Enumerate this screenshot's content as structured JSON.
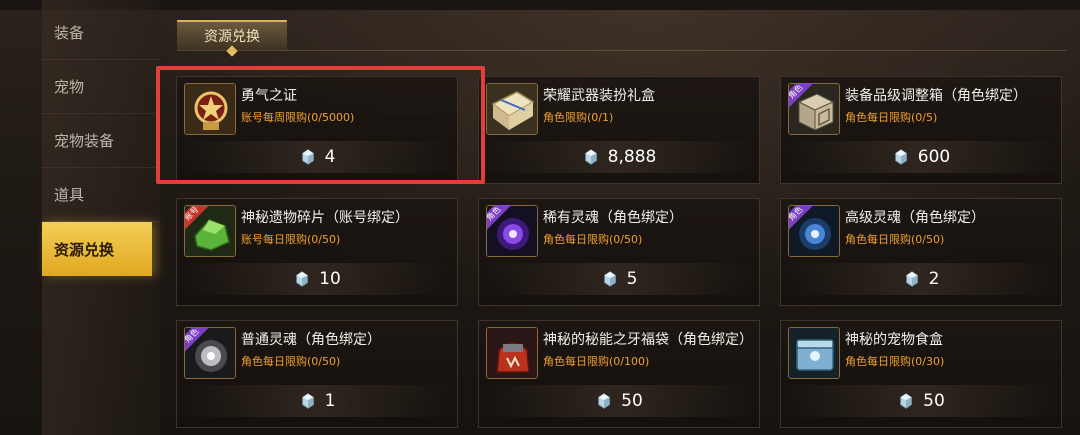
{
  "sidebar": {
    "items": [
      {
        "label": "装备"
      },
      {
        "label": "宠物"
      },
      {
        "label": "宠物装备"
      },
      {
        "label": "道具"
      },
      {
        "label": "资源兑换"
      }
    ],
    "active": "资源兑换"
  },
  "tabs": [
    {
      "label": "资源兑换"
    }
  ],
  "currency_icon": "gem-icon",
  "colors": {
    "accent": "#f0a030",
    "highlight": "#e0403c",
    "active_tab": "#e8b93a"
  },
  "items": [
    {
      "name": "勇气之证",
      "limit": "账号每周限购(0/5000)",
      "price": "4",
      "icon": "medal-icon",
      "badge": ""
    },
    {
      "name": "荣耀武器装扮礼盒",
      "limit": "角色限购(0/1)",
      "price": "8,888",
      "icon": "gift-box-icon",
      "badge": ""
    },
    {
      "name": "装备品级调整箱（角色绑定）",
      "limit": "角色每日限购(0/5)",
      "price": "600",
      "icon": "cube-box-icon",
      "badge": "角色"
    },
    {
      "name": "神秘遗物碎片（账号绑定）",
      "limit": "账号每日限购(0/50)",
      "price": "10",
      "icon": "relic-fragment-icon",
      "badge": "账号"
    },
    {
      "name": "稀有灵魂（角色绑定）",
      "limit": "角色每日限购(0/50)",
      "price": "5",
      "icon": "rare-soul-icon",
      "badge": "角色"
    },
    {
      "name": "高级灵魂（角色绑定）",
      "limit": "角色每日限购(0/50)",
      "price": "2",
      "icon": "advanced-soul-icon",
      "badge": "角色"
    },
    {
      "name": "普通灵魂（角色绑定）",
      "limit": "角色每日限购(0/50)",
      "price": "1",
      "icon": "common-soul-icon",
      "badge": "角色"
    },
    {
      "name": "神秘的秘能之牙福袋（角色绑定）",
      "limit": "角色每日限购(0/100)",
      "price": "50",
      "icon": "fang-bag-icon",
      "badge": ""
    },
    {
      "name": "神秘的宠物食盒",
      "limit": "角色每日限购(0/30)",
      "price": "50",
      "icon": "pet-food-box-icon",
      "badge": ""
    }
  ]
}
